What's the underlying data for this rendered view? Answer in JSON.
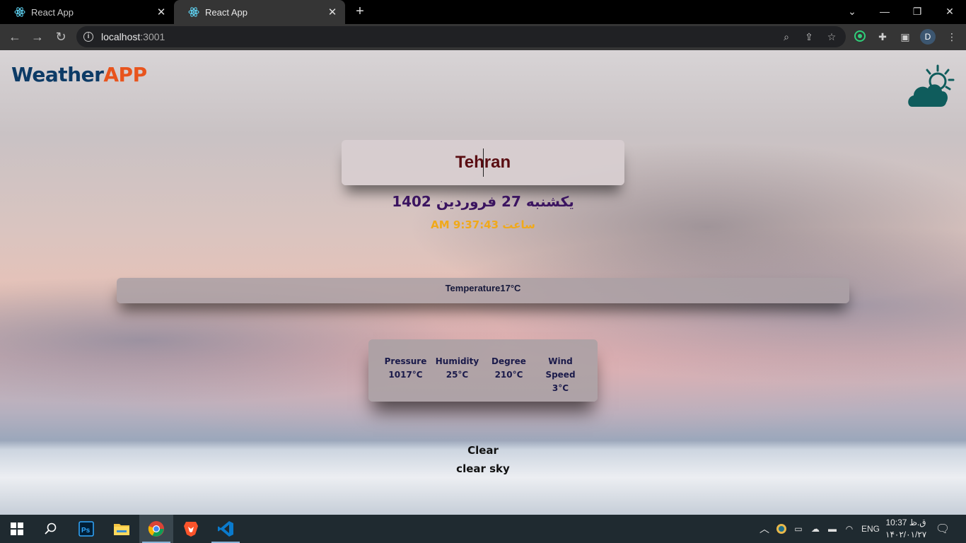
{
  "browser": {
    "tabs": [
      {
        "title": "React App",
        "active": false
      },
      {
        "title": "React App",
        "active": true
      }
    ],
    "new_tab_symbol": "+",
    "url_host": "localhost",
    "url_port": ":3001",
    "profile_initial": "D"
  },
  "app": {
    "logo_weather": "Weather",
    "logo_app": "APP",
    "city": "Tehran",
    "date": "یکشنبه 27 فروردین 1402",
    "time": "ساعت 9:37:43 AM",
    "temperature": "Temperature17°C",
    "details": {
      "pressure_label": "Pressure",
      "pressure_value": "1017°C",
      "humidity_label": "Humidity",
      "humidity_value": "25°C",
      "degree_label": "Degree",
      "degree_value": "210°C",
      "wind_label_1": "Wind",
      "wind_label_2": "Speed",
      "wind_value": "3°C"
    },
    "condition_main": "Clear",
    "condition_description": "clear sky"
  },
  "taskbar": {
    "apps": [
      "start",
      "search",
      "photoshop",
      "file-explorer",
      "chrome",
      "brave",
      "vscode"
    ],
    "language": "ENG",
    "time": "10:37 ق.ظ",
    "date": "۱۴۰۲/۰۱/۲۷"
  },
  "colors": {
    "logo_blue": "#0d3b66",
    "logo_orange": "#e8541d",
    "city_text": "#5a0d12",
    "date_text": "#3b1460",
    "time_text": "#f0a91a"
  }
}
